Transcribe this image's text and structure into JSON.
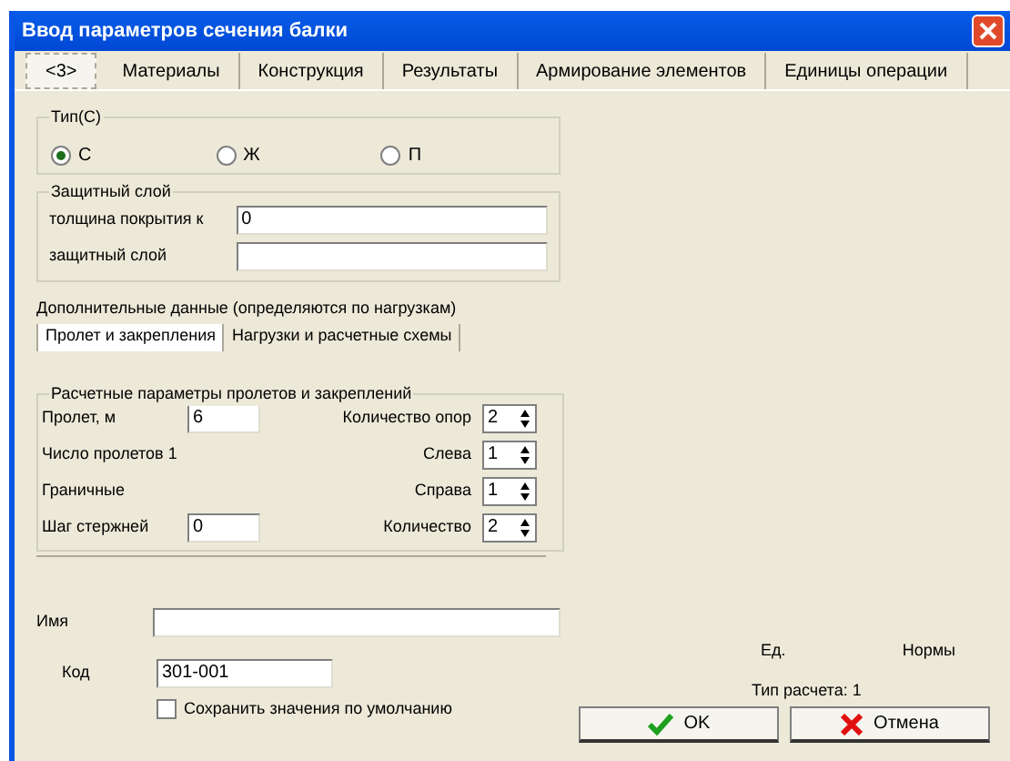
{
  "window": {
    "title": "Ввод параметров сечения балки"
  },
  "tabs": [
    {
      "label": "<3>",
      "selected": true
    },
    {
      "label": "Материалы",
      "selected": false
    },
    {
      "label": "Конструкция",
      "selected": false
    },
    {
      "label": "Результаты",
      "selected": false
    },
    {
      "label": "Армирование элементов",
      "selected": false
    },
    {
      "label": "Единицы операции",
      "selected": false
    }
  ],
  "type_group": {
    "title": "Тип(С)",
    "options": [
      {
        "label": "С",
        "selected": true
      },
      {
        "label": "Ж",
        "selected": false
      },
      {
        "label": "П",
        "selected": false
      }
    ]
  },
  "cover_group": {
    "title": "Защитный слой",
    "fields": [
      {
        "label": "толщина покрытия к",
        "value": "0"
      },
      {
        "label": "защитный слой"
      }
    ]
  },
  "extra_note": "Дополнительные данные (определяются по нагрузкам)",
  "subtabs": [
    {
      "label": "Пролет и закрепления",
      "selected": true
    },
    {
      "label": "Нагрузки и расчетные схемы",
      "selected": false
    }
  ],
  "span_group": {
    "title": "Расчетные параметры пролетов и закреплений",
    "left": [
      {
        "label": "Пролет, м",
        "value": "6"
      },
      {
        "label": "Число пролетов 1"
      },
      {
        "label": "Граничные"
      },
      {
        "label": "Шаг стержней",
        "value": "0"
      }
    ],
    "right": [
      {
        "label": "Количество опор",
        "value": "2"
      },
      {
        "label": "Слева",
        "value": "1"
      },
      {
        "label": "Справа",
        "value": "1"
      },
      {
        "label": "Количество",
        "value": "2"
      }
    ]
  },
  "name_field": {
    "label": "Имя"
  },
  "code_field": {
    "label": "Код",
    "value": "301-001"
  },
  "option": {
    "label": "Сохранить значения по умолчанию",
    "checked": false
  },
  "info": [
    {
      "text": "Ед."
    },
    {
      "text": "Нормы"
    },
    {
      "text": "Тип расчета: 1"
    }
  ],
  "buttons": [
    {
      "label": "OK",
      "kind": "ok"
    },
    {
      "label": "Отмена",
      "kind": "cancel"
    }
  ]
}
